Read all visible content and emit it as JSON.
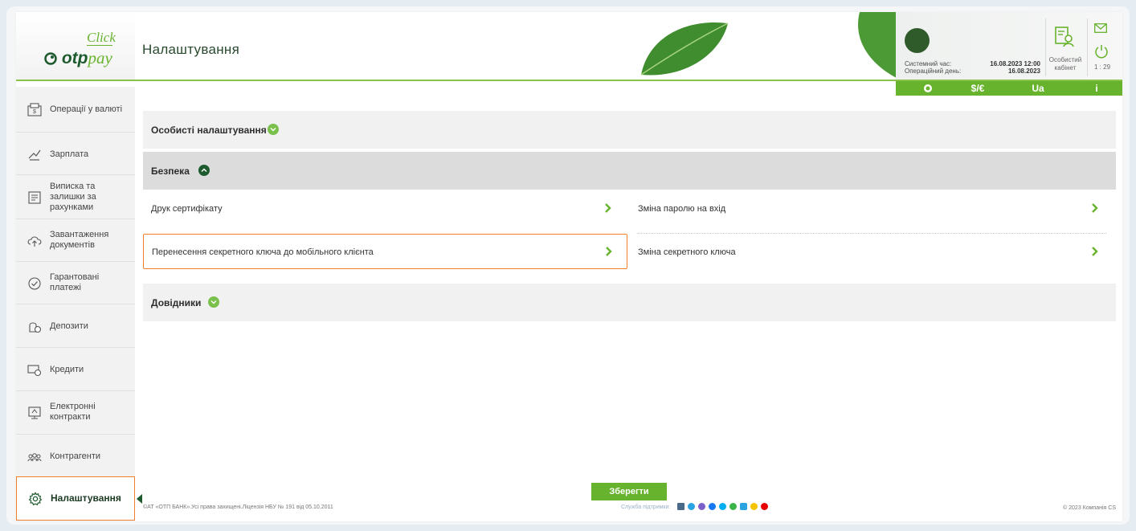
{
  "logo": {
    "click": "Click",
    "otp": "otp",
    "pay": "pay"
  },
  "page_title": "Налаштування",
  "system": {
    "sys_time_label": "Системний час:",
    "sys_time_value": "16.08.2023 12:00",
    "op_day_label": "Операційний день:",
    "op_day_value": "16.08.2023",
    "cabinet_label": "Особистий кабінет",
    "timer": "1 : 29"
  },
  "quick_bar": {
    "currency": "$/€",
    "lang": "Ua",
    "info": "i"
  },
  "sidebar": {
    "items": [
      {
        "label": "Операції у валюті",
        "icon": "currency-ops-icon"
      },
      {
        "label": "Зарплата",
        "icon": "salary-icon"
      },
      {
        "label": "Виписка та залишки за рахунками",
        "icon": "statement-icon"
      },
      {
        "label": "Завантаження документів",
        "icon": "upload-cloud-icon"
      },
      {
        "label": "Гарантовані платежі",
        "icon": "guaranteed-payments-icon"
      },
      {
        "label": "Депозити",
        "icon": "deposit-icon"
      },
      {
        "label": "Кредити",
        "icon": "credit-icon"
      },
      {
        "label": "Електронні контракти",
        "icon": "e-contract-icon"
      },
      {
        "label": "Контрагенти",
        "icon": "counterparties-icon"
      },
      {
        "label": "Налаштування",
        "icon": "gear-icon"
      }
    ]
  },
  "sections": {
    "personal": "Особисті налаштування",
    "security": "Безпека",
    "directories": "Довідники"
  },
  "security_links": {
    "print_cert": "Друк сертифікату",
    "change_password": "Зміна паролю на вхід",
    "transfer_key": "Перенесення секретного ключа до мобільного клієнта",
    "change_key": "Зміна секретного ключа"
  },
  "save_label": "Зберегти",
  "footer": {
    "copyright": "©АТ «ОТП БАНК».Усі права захищені.Ліцензія НБУ № 191 від 05.10.2011",
    "support": "Служба підтримки:",
    "company": "© 2023 Компанія CS"
  },
  "colors": {
    "brand_green": "#67b32e",
    "dark_green": "#1d5a2d",
    "highlight_orange": "#f07f2d"
  }
}
